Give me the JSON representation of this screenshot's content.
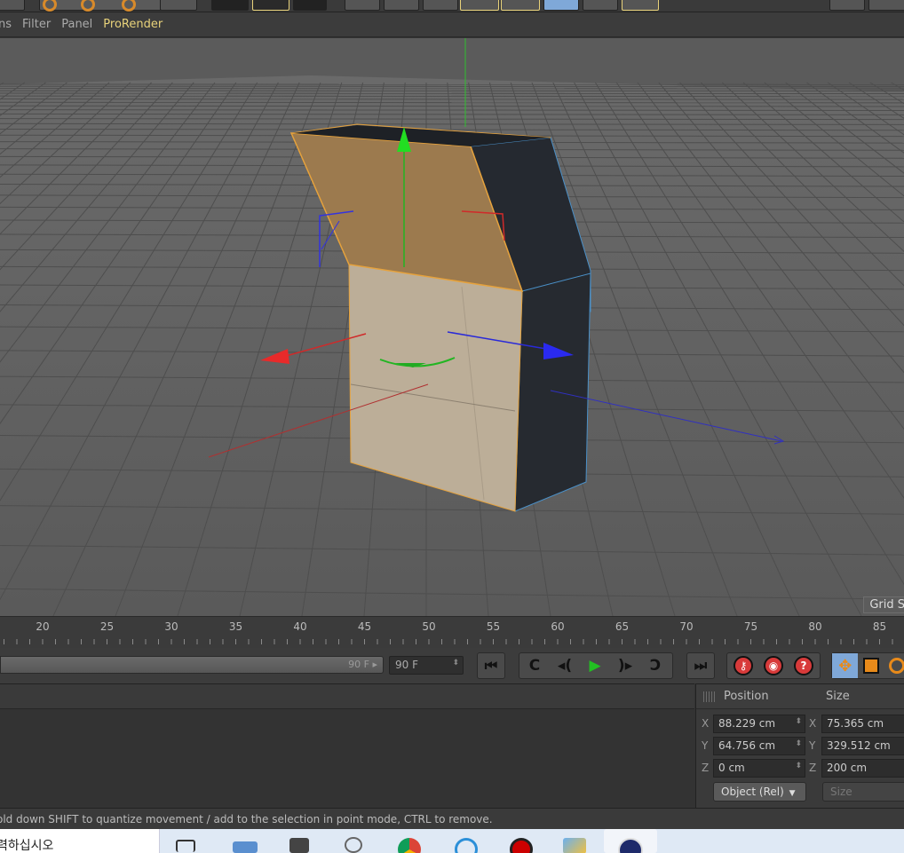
{
  "menu": {
    "items": [
      {
        "label": "ns"
      },
      {
        "label": "Filter"
      },
      {
        "label": "Panel"
      },
      {
        "label": "ProRender"
      }
    ]
  },
  "viewport": {
    "grid_label": "Grid S"
  },
  "timeline": {
    "ticks": [
      "20",
      "25",
      "30",
      "35",
      "40",
      "45",
      "50",
      "55",
      "60",
      "65",
      "70",
      "75",
      "80",
      "85"
    ],
    "slider_end_label": "90 F",
    "end_frame_field": "90 F"
  },
  "coordinates": {
    "position_header": "Position",
    "size_header": "Size",
    "rows": [
      {
        "axis": "X",
        "position": "88.229 cm",
        "size_axis": "X",
        "size": "75.365 cm"
      },
      {
        "axis": "Y",
        "position": "64.756 cm",
        "size_axis": "Y",
        "size": "329.512 cm"
      },
      {
        "axis": "Z",
        "position": "0 cm",
        "size_axis": "Z",
        "size": "200 cm"
      }
    ],
    "coord_mode_dropdown": "Object (Rel)",
    "size_mode_dropdown": "Size"
  },
  "status": {
    "message": "old down SHIFT to quantize movement / add to the selection in point mode, CTRL to remove."
  },
  "taskbar": {
    "search_text": "력하십시오"
  },
  "colors": {
    "accent": "#e8d27a",
    "axis_x": "#d83030",
    "axis_y": "#2fbf2f",
    "axis_z": "#3a3ae0",
    "selected_face": "#b08a55",
    "face_front": "#bcae98",
    "face_dark": "#262a30",
    "viewport_bg": "#5a5a5a"
  }
}
